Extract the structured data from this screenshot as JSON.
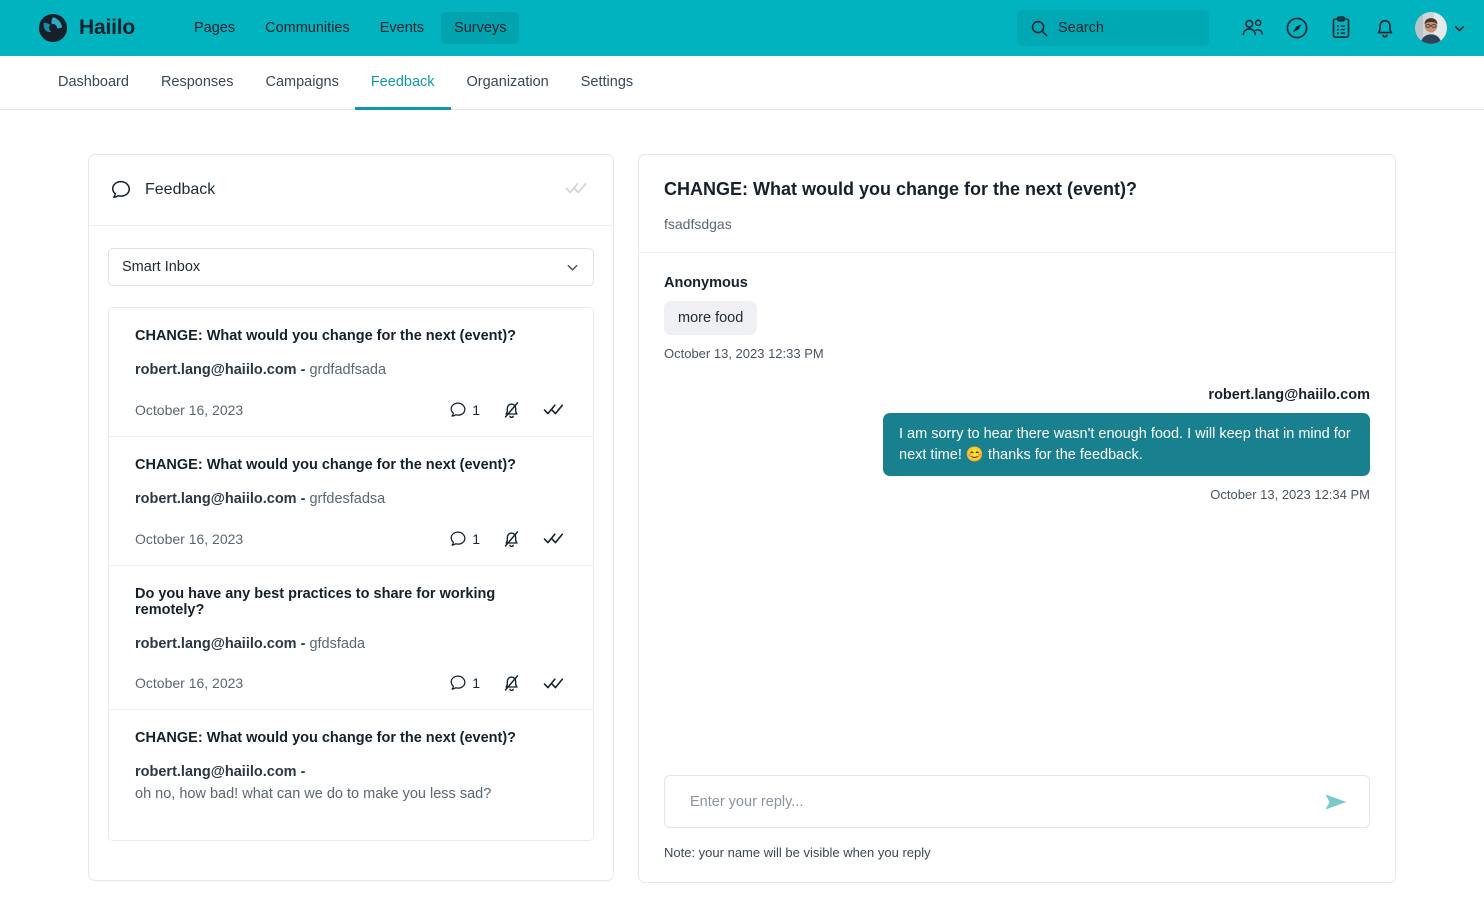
{
  "colors": {
    "brand_teal": "#00b3bf",
    "brand_teal_dark": "#00a3ae",
    "accent": "#109aa6",
    "bubble_out": "#19808f",
    "send_arrow": "#7dc9c9"
  },
  "topbar": {
    "brand_name": "Haiilo",
    "nav": [
      {
        "label": "Pages",
        "active": false
      },
      {
        "label": "Communities",
        "active": false
      },
      {
        "label": "Events",
        "active": false
      },
      {
        "label": "Surveys",
        "active": true
      }
    ],
    "search": {
      "placeholder": "Search",
      "value": ""
    },
    "icons": [
      {
        "name": "people-icon"
      },
      {
        "name": "compass-icon"
      },
      {
        "name": "clipboard-icon"
      },
      {
        "name": "bell-icon"
      }
    ]
  },
  "subnav": {
    "items": [
      {
        "label": "Dashboard",
        "active": false
      },
      {
        "label": "Responses",
        "active": false
      },
      {
        "label": "Campaigns",
        "active": false
      },
      {
        "label": "Feedback",
        "active": true
      },
      {
        "label": "Organization",
        "active": false
      },
      {
        "label": "Settings",
        "active": false
      }
    ]
  },
  "left_panel": {
    "header_title": "Feedback",
    "filter": {
      "selected": "Smart Inbox"
    },
    "items": [
      {
        "title": "CHANGE: What would you change for the next (event)?",
        "author": "robert.lang@haiilo.com",
        "separator": " - ",
        "snippet": "grdfadfsada",
        "date": "October 16, 2023",
        "comment_count": "1"
      },
      {
        "title": "CHANGE: What would you change for the next (event)?",
        "author": "robert.lang@haiilo.com",
        "separator": " - ",
        "snippet": "grfdesfadsa",
        "date": "October 16, 2023",
        "comment_count": "1"
      },
      {
        "title": "Do you have any best practices to share for working remotely?",
        "author": "robert.lang@haiilo.com",
        "separator": " - ",
        "snippet": "gfdsfada",
        "date": "October 16, 2023",
        "comment_count": "1"
      },
      {
        "title": "CHANGE: What would you change for the next (event)?",
        "author": "robert.lang@haiilo.com",
        "separator": " - ",
        "snippet": "oh no, how bad! what can we do to make you less sad?",
        "date": "",
        "comment_count": ""
      }
    ]
  },
  "right_panel": {
    "title": "CHANGE: What would you change for the next (event)?",
    "subtitle": "fsadfsdgas",
    "messages": [
      {
        "author": "Anonymous",
        "text": "more food",
        "time": "October 13, 2023 12:33 PM",
        "direction": "in"
      },
      {
        "author": "robert.lang@haiilo.com",
        "text": "I am sorry to hear there wasn't enough food. I will keep that in mind for next time! 😊 thanks for the feedback.",
        "time": "October 13, 2023 12:34 PM",
        "direction": "out"
      }
    ],
    "reply": {
      "placeholder": "Enter your reply...",
      "value": "",
      "note": "Note: your name will be visible when you reply"
    }
  }
}
